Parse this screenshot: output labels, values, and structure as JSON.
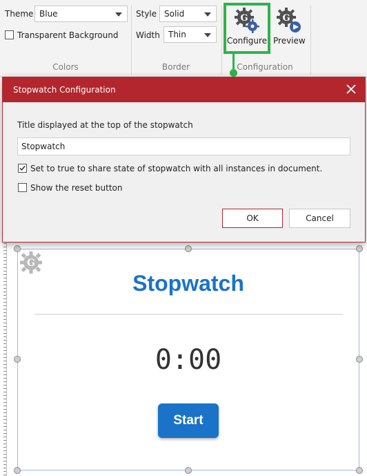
{
  "ribbon": {
    "theme_label": "Theme",
    "theme_value": "Blue",
    "transparent_bg_label": "Transparent Background",
    "transparent_bg_checked": false,
    "colors_group": "Colors",
    "style_label": "Style",
    "style_value": "Solid",
    "width_label": "Width",
    "width_value": "Thin",
    "border_group": "Border",
    "configure_label": "Configure",
    "preview_label": "Preview",
    "configuration_group": "Configuration",
    "highlight_color": "#2fb34a"
  },
  "dialog": {
    "title": "Stopwatch Configuration",
    "title_field_label": "Title displayed at the top of the stopwatch",
    "title_field_value": "Stopwatch",
    "share_state_label": "Set to true to share state of stopwatch with all instances in document.",
    "share_state_checked": true,
    "reset_button_label": "Show the reset button",
    "reset_button_checked": false,
    "ok_label": "OK",
    "cancel_label": "Cancel",
    "header_color": "#b3262e"
  },
  "stopwatch": {
    "title": "Stopwatch",
    "time": "0:00",
    "start_label": "Start",
    "accent_color": "#1a73c9"
  }
}
